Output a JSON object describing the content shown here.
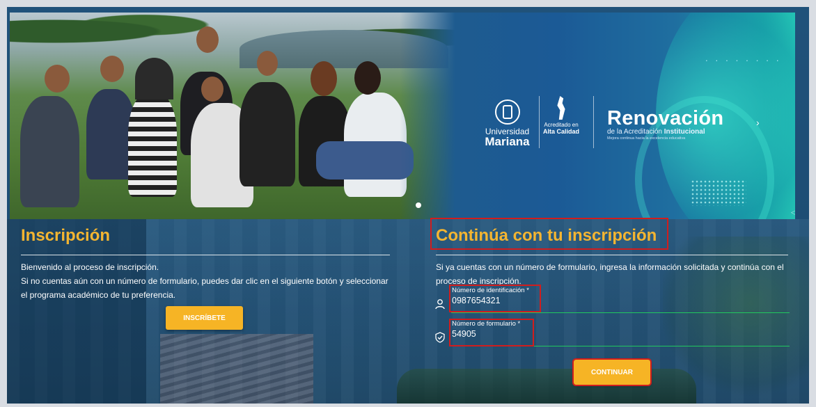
{
  "hero": {
    "university_line1": "Universidad",
    "university_line2": "Mariana",
    "accredited_line1": "Acreditado en",
    "accredited_line2": "Alta Calidad",
    "renovation_title": "Renovación",
    "renovation_sub_pre": "de la Acreditación ",
    "renovation_sub_bold": "Institucional",
    "renovation_tagline": "Mejora continua hacia la excelencia educativa",
    "dots_glyph": "· · · · · · · ·",
    "next_glyph": "›",
    "prev_glyph": "◁"
  },
  "inscripcion": {
    "title": "Inscripción",
    "line1": "Bienvenido al proceso de inscripción.",
    "line2": "Si no cuentas aún con un número de formulario, puedes dar clic en el siguiente botón y seleccionar el programa académico de tu preferencia.",
    "button": "INSCRÍBETE"
  },
  "continua": {
    "title": "Continúa con tu inscripción",
    "text": "Si ya cuentas con un número de formulario, ingresa la información solicitada y continúa con el proceso de inscripción.",
    "id_label": "Número de identificación *",
    "id_value": "0987654321",
    "form_label": "Número de formulario *",
    "form_value": "54905",
    "button": "CONTINUAR"
  },
  "colors": {
    "accent": "#f4b531",
    "button": "#f6b425",
    "highlight_box": "#d11d1d",
    "field_line": "#21c95e",
    "background": "#1d4d74"
  }
}
